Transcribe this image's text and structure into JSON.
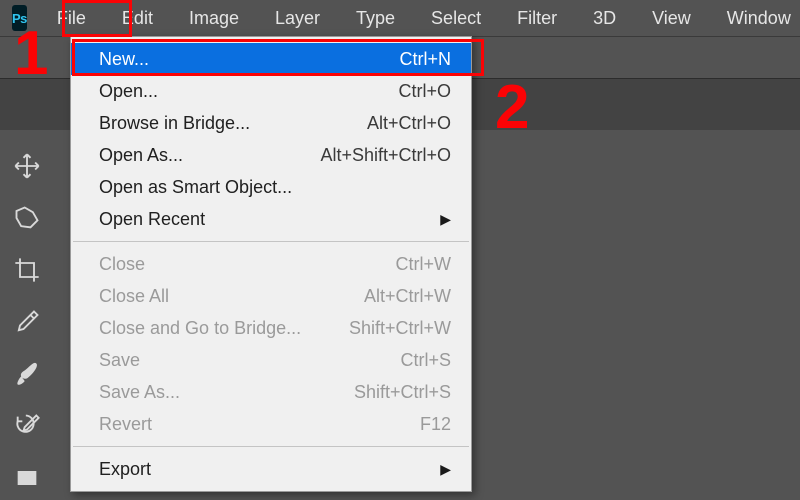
{
  "app": {
    "badge": "Ps"
  },
  "menubar": {
    "items": [
      "File",
      "Edit",
      "Image",
      "Layer",
      "Type",
      "Select",
      "Filter",
      "3D",
      "View",
      "Window"
    ]
  },
  "dropdown": {
    "groups": [
      [
        {
          "label": "New...",
          "shortcut": "Ctrl+N",
          "highlight": true
        },
        {
          "label": "Open...",
          "shortcut": "Ctrl+O"
        },
        {
          "label": "Browse in Bridge...",
          "shortcut": "Alt+Ctrl+O"
        },
        {
          "label": "Open As...",
          "shortcut": "Alt+Shift+Ctrl+O"
        },
        {
          "label": "Open as Smart Object...",
          "shortcut": ""
        },
        {
          "label": "Open Recent",
          "shortcut": "",
          "submenu": true
        }
      ],
      [
        {
          "label": "Close",
          "shortcut": "Ctrl+W",
          "disabled": true
        },
        {
          "label": "Close All",
          "shortcut": "Alt+Ctrl+W",
          "disabled": true
        },
        {
          "label": "Close and Go to Bridge...",
          "shortcut": "Shift+Ctrl+W",
          "disabled": true
        },
        {
          "label": "Save",
          "shortcut": "Ctrl+S",
          "disabled": true
        },
        {
          "label": "Save As...",
          "shortcut": "Shift+Ctrl+S",
          "disabled": true
        },
        {
          "label": "Revert",
          "shortcut": "F12",
          "disabled": true
        }
      ],
      [
        {
          "label": "Export",
          "shortcut": "",
          "submenu": true
        }
      ]
    ]
  },
  "annotations": {
    "n1": "1",
    "n2": "2"
  }
}
